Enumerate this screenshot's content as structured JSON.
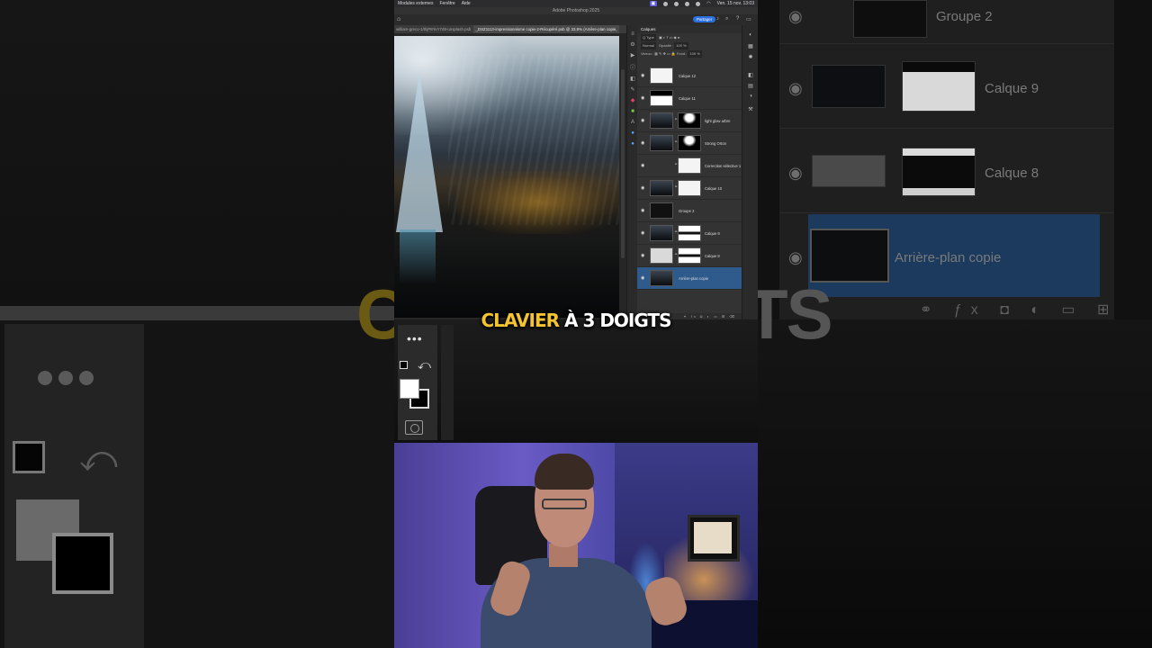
{
  "menubar": {
    "items": [
      "Modules externes",
      "Fenêtre",
      "Aide"
    ],
    "clock": "Ven. 15 nov.  13:03"
  },
  "app": {
    "title": "Adobe Photoshop 2025"
  },
  "options_bar": {
    "share_label": "Partager"
  },
  "documents": {
    "tabs": [
      "william-greco-1/thjP8YvY7d8-unsplash.psb",
      "_DSZ1113-impressionnisme copie-2-Récupéré.psb @ 33,9% (Arrière-plan copie,"
    ]
  },
  "layers_panel": {
    "title": "Calques",
    "filter_label": "Q Type",
    "blend_mode": "Normal",
    "opacity_label": "Opacité :",
    "opacity_value": "100 %",
    "lock_label": "Verrou :",
    "fill_label": "Fond :",
    "fill_value": "100 %",
    "layers": [
      {
        "name": "Calque 12",
        "thumb1": "th-white",
        "thumb2": "",
        "selected": false
      },
      {
        "name": "Calque 11",
        "thumb1": "th-mask",
        "thumb2": "",
        "selected": false
      },
      {
        "name": "light glow arbre",
        "thumb1": "th-dark",
        "thumb2": "th-mask2",
        "selected": false
      },
      {
        "name": "Strong Orton",
        "thumb1": "th-dark",
        "thumb2": "th-mask2",
        "selected": false
      },
      {
        "name": "Correction sélective 1",
        "thumb1": "",
        "thumb2": "th-white",
        "selected": false
      },
      {
        "name": "Calque 10",
        "thumb1": "th-dark",
        "thumb2": "th-white",
        "selected": false
      },
      {
        "name": "Groupe 2",
        "thumb1": "th-group",
        "thumb2": "",
        "selected": false
      },
      {
        "name": "Calque 9",
        "thumb1": "th-dark",
        "thumb2": "th-mask3",
        "selected": false
      },
      {
        "name": "Calque 8",
        "thumb1": "th-grey",
        "thumb2": "th-mask3",
        "selected": false
      },
      {
        "name": "Arrière-plan copie",
        "thumb1": "th-dark",
        "thumb2": "",
        "selected": true
      }
    ]
  },
  "toolbar": {
    "more_label": "•••"
  },
  "caption": {
    "highlight": "CLAVIER",
    "rest": "À 3 DOIGTS"
  },
  "backdrop": {
    "left_fragment": "CL",
    "right_fragment": "TS",
    "right_layers": [
      "Groupe 2",
      "Calque 9",
      "Calque 8",
      "Arrière-plan copie"
    ]
  },
  "colors": {
    "caption_yellow": "#f4c430",
    "selection_blue": "#2f5a8c",
    "share_blue": "#2b6fe0"
  }
}
